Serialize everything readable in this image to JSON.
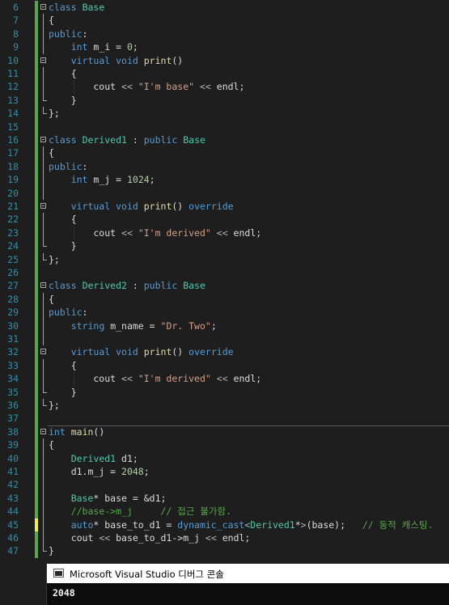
{
  "editor": {
    "lines": [
      {
        "n": "6",
        "fold": "box",
        "chg": "saved",
        "sep": false,
        "guides": [],
        "tokens": [
          [
            "kw",
            "class"
          ],
          [
            "pl",
            " "
          ],
          [
            "ty",
            "Base"
          ]
        ]
      },
      {
        "n": "7",
        "fold": "line",
        "chg": "saved",
        "sep": false,
        "guides": [],
        "tokens": [
          [
            "pl",
            "{"
          ]
        ]
      },
      {
        "n": "8",
        "fold": "line",
        "chg": "saved",
        "sep": false,
        "guides": [],
        "tokens": [
          [
            "kw",
            "public"
          ],
          [
            "pl",
            ":"
          ]
        ]
      },
      {
        "n": "9",
        "fold": "line",
        "chg": "saved",
        "sep": false,
        "guides": [],
        "tokens": [
          [
            "pl",
            "    "
          ],
          [
            "kw",
            "int"
          ],
          [
            "pl",
            " "
          ],
          [
            "mem",
            "m_i"
          ],
          [
            "pl",
            " = "
          ],
          [
            "nm",
            "0"
          ],
          [
            "pl",
            ";"
          ]
        ]
      },
      {
        "n": "10",
        "fold": "box",
        "chg": "saved",
        "sep": false,
        "guides": [],
        "tokens": [
          [
            "pl",
            "    "
          ],
          [
            "kw",
            "virtual"
          ],
          [
            "pl",
            " "
          ],
          [
            "kw",
            "void"
          ],
          [
            "pl",
            " "
          ],
          [
            "fn",
            "print"
          ],
          [
            "pl",
            "()"
          ]
        ]
      },
      {
        "n": "11",
        "fold": "line",
        "chg": "saved",
        "sep": false,
        "guides": [],
        "tokens": [
          [
            "pl",
            "    {"
          ]
        ]
      },
      {
        "n": "12",
        "fold": "line",
        "chg": "saved",
        "sep": false,
        "guides": [
          1
        ],
        "tokens": [
          [
            "pl",
            "        cout "
          ],
          [
            "op",
            "<<"
          ],
          [
            "pl",
            " "
          ],
          [
            "st",
            "\"I'm base\""
          ],
          [
            "pl",
            " "
          ],
          [
            "op",
            "<<"
          ],
          [
            "pl",
            " endl;"
          ]
        ]
      },
      {
        "n": "13",
        "fold": "end",
        "chg": "saved",
        "sep": false,
        "guides": [],
        "tokens": [
          [
            "pl",
            "    }"
          ]
        ]
      },
      {
        "n": "14",
        "fold": "end",
        "chg": "saved",
        "sep": false,
        "guides": [],
        "tokens": [
          [
            "pl",
            "};"
          ]
        ]
      },
      {
        "n": "15",
        "fold": "none",
        "chg": "saved",
        "sep": false,
        "guides": [],
        "tokens": []
      },
      {
        "n": "16",
        "fold": "box",
        "chg": "saved",
        "sep": false,
        "guides": [],
        "tokens": [
          [
            "kw",
            "class"
          ],
          [
            "pl",
            " "
          ],
          [
            "ty",
            "Derived1"
          ],
          [
            "pl",
            " : "
          ],
          [
            "kw",
            "public"
          ],
          [
            "pl",
            " "
          ],
          [
            "ty",
            "Base"
          ]
        ]
      },
      {
        "n": "17",
        "fold": "line",
        "chg": "saved",
        "sep": false,
        "guides": [],
        "tokens": [
          [
            "pl",
            "{"
          ]
        ]
      },
      {
        "n": "18",
        "fold": "line",
        "chg": "saved",
        "sep": false,
        "guides": [],
        "tokens": [
          [
            "kw",
            "public"
          ],
          [
            "pl",
            ":"
          ]
        ]
      },
      {
        "n": "19",
        "fold": "line",
        "chg": "saved",
        "sep": false,
        "guides": [],
        "tokens": [
          [
            "pl",
            "    "
          ],
          [
            "kw",
            "int"
          ],
          [
            "pl",
            " "
          ],
          [
            "mem",
            "m_j"
          ],
          [
            "pl",
            " = "
          ],
          [
            "nm",
            "1024"
          ],
          [
            "pl",
            ";"
          ]
        ]
      },
      {
        "n": "20",
        "fold": "line",
        "chg": "saved",
        "sep": false,
        "guides": [],
        "tokens": []
      },
      {
        "n": "21",
        "fold": "box",
        "chg": "saved",
        "sep": false,
        "guides": [],
        "tokens": [
          [
            "pl",
            "    "
          ],
          [
            "kw",
            "virtual"
          ],
          [
            "pl",
            " "
          ],
          [
            "kw",
            "void"
          ],
          [
            "pl",
            " "
          ],
          [
            "fn",
            "print"
          ],
          [
            "pl",
            "() "
          ],
          [
            "kw",
            "override"
          ]
        ]
      },
      {
        "n": "22",
        "fold": "line",
        "chg": "saved",
        "sep": false,
        "guides": [],
        "tokens": [
          [
            "pl",
            "    {"
          ]
        ]
      },
      {
        "n": "23",
        "fold": "line",
        "chg": "saved",
        "sep": false,
        "guides": [
          1
        ],
        "tokens": [
          [
            "pl",
            "        cout "
          ],
          [
            "op",
            "<<"
          ],
          [
            "pl",
            " "
          ],
          [
            "st",
            "\"I'm derived\""
          ],
          [
            "pl",
            " "
          ],
          [
            "op",
            "<<"
          ],
          [
            "pl",
            " endl;"
          ]
        ]
      },
      {
        "n": "24",
        "fold": "end",
        "chg": "saved",
        "sep": false,
        "guides": [],
        "tokens": [
          [
            "pl",
            "    }"
          ]
        ]
      },
      {
        "n": "25",
        "fold": "end",
        "chg": "saved",
        "sep": false,
        "guides": [],
        "tokens": [
          [
            "pl",
            "};"
          ]
        ]
      },
      {
        "n": "26",
        "fold": "none",
        "chg": "saved",
        "sep": false,
        "guides": [],
        "tokens": []
      },
      {
        "n": "27",
        "fold": "box",
        "chg": "saved",
        "sep": false,
        "guides": [],
        "tokens": [
          [
            "kw",
            "class"
          ],
          [
            "pl",
            " "
          ],
          [
            "ty",
            "Derived2"
          ],
          [
            "pl",
            " : "
          ],
          [
            "kw",
            "public"
          ],
          [
            "pl",
            " "
          ],
          [
            "ty",
            "Base"
          ]
        ]
      },
      {
        "n": "28",
        "fold": "line",
        "chg": "saved",
        "sep": false,
        "guides": [],
        "tokens": [
          [
            "pl",
            "{"
          ]
        ]
      },
      {
        "n": "29",
        "fold": "line",
        "chg": "saved",
        "sep": false,
        "guides": [],
        "tokens": [
          [
            "kw",
            "public"
          ],
          [
            "pl",
            ":"
          ]
        ]
      },
      {
        "n": "30",
        "fold": "line",
        "chg": "saved",
        "sep": false,
        "guides": [],
        "tokens": [
          [
            "pl",
            "    "
          ],
          [
            "kw",
            "string"
          ],
          [
            "pl",
            " "
          ],
          [
            "mem",
            "m_name"
          ],
          [
            "pl",
            " = "
          ],
          [
            "st",
            "\"Dr. Two\""
          ],
          [
            "pl",
            ";"
          ]
        ]
      },
      {
        "n": "31",
        "fold": "line",
        "chg": "saved",
        "sep": false,
        "guides": [],
        "tokens": []
      },
      {
        "n": "32",
        "fold": "box",
        "chg": "saved",
        "sep": false,
        "guides": [],
        "tokens": [
          [
            "pl",
            "    "
          ],
          [
            "kw",
            "virtual"
          ],
          [
            "pl",
            " "
          ],
          [
            "kw",
            "void"
          ],
          [
            "pl",
            " "
          ],
          [
            "fn",
            "print"
          ],
          [
            "pl",
            "() "
          ],
          [
            "kw",
            "override"
          ]
        ]
      },
      {
        "n": "33",
        "fold": "line",
        "chg": "saved",
        "sep": false,
        "guides": [],
        "tokens": [
          [
            "pl",
            "    {"
          ]
        ]
      },
      {
        "n": "34",
        "fold": "line",
        "chg": "saved",
        "sep": false,
        "guides": [
          1
        ],
        "tokens": [
          [
            "pl",
            "        cout "
          ],
          [
            "op",
            "<<"
          ],
          [
            "pl",
            " "
          ],
          [
            "st",
            "\"I'm derived\""
          ],
          [
            "pl",
            " "
          ],
          [
            "op",
            "<<"
          ],
          [
            "pl",
            " endl;"
          ]
        ]
      },
      {
        "n": "35",
        "fold": "end",
        "chg": "saved",
        "sep": false,
        "guides": [],
        "tokens": [
          [
            "pl",
            "    }"
          ]
        ]
      },
      {
        "n": "36",
        "fold": "end",
        "chg": "saved",
        "sep": false,
        "guides": [],
        "tokens": [
          [
            "pl",
            "};"
          ]
        ]
      },
      {
        "n": "37",
        "fold": "none",
        "chg": "saved",
        "sep": false,
        "guides": [],
        "tokens": []
      },
      {
        "n": "38",
        "fold": "box",
        "chg": "saved",
        "sep": true,
        "guides": [],
        "tokens": [
          [
            "kw",
            "int"
          ],
          [
            "pl",
            " "
          ],
          [
            "fn",
            "main"
          ],
          [
            "pl",
            "()"
          ]
        ]
      },
      {
        "n": "39",
        "fold": "line",
        "chg": "saved",
        "sep": false,
        "guides": [],
        "tokens": [
          [
            "pl",
            "{"
          ]
        ]
      },
      {
        "n": "40",
        "fold": "line",
        "chg": "saved",
        "sep": false,
        "guides": [],
        "tokens": [
          [
            "pl",
            "    "
          ],
          [
            "ty",
            "Derived1"
          ],
          [
            "pl",
            " d1;"
          ]
        ]
      },
      {
        "n": "41",
        "fold": "line",
        "chg": "saved",
        "sep": false,
        "guides": [],
        "tokens": [
          [
            "pl",
            "    d1."
          ],
          [
            "mem",
            "m_j"
          ],
          [
            "pl",
            " = "
          ],
          [
            "nm",
            "2048"
          ],
          [
            "pl",
            ";"
          ]
        ]
      },
      {
        "n": "42",
        "fold": "line",
        "chg": "saved",
        "sep": false,
        "guides": [],
        "tokens": []
      },
      {
        "n": "43",
        "fold": "line",
        "chg": "saved",
        "sep": false,
        "guides": [],
        "tokens": [
          [
            "pl",
            "    "
          ],
          [
            "ty",
            "Base"
          ],
          [
            "pl",
            "* base = &d1;"
          ]
        ]
      },
      {
        "n": "44",
        "fold": "line",
        "chg": "saved",
        "sep": false,
        "guides": [],
        "tokens": [
          [
            "pl",
            "    "
          ],
          [
            "cm",
            "//base->m_j     // 접근 불가함."
          ]
        ]
      },
      {
        "n": "45",
        "fold": "line",
        "chg": "unsaved",
        "sep": false,
        "guides": [],
        "tokens": [
          [
            "pl",
            "    "
          ],
          [
            "kw",
            "auto"
          ],
          [
            "pl",
            "* base_to_d1 = "
          ],
          [
            "kw",
            "dynamic_cast"
          ],
          [
            "op",
            "<"
          ],
          [
            "ty",
            "Derived1"
          ],
          [
            "pl",
            "*"
          ],
          [
            "op",
            ">"
          ],
          [
            "pl",
            "(base);   "
          ],
          [
            "cm",
            "// 동적 캐스팅."
          ]
        ]
      },
      {
        "n": "46",
        "fold": "line",
        "chg": "saved",
        "sep": false,
        "guides": [],
        "tokens": [
          [
            "pl",
            "    cout "
          ],
          [
            "op",
            "<<"
          ],
          [
            "pl",
            " base_to_d1->"
          ],
          [
            "mem",
            "m_j"
          ],
          [
            "pl",
            " "
          ],
          [
            "op",
            "<<"
          ],
          [
            "pl",
            " endl;"
          ]
        ]
      },
      {
        "n": "47",
        "fold": "end",
        "chg": "saved",
        "sep": false,
        "guides": [],
        "tokens": [
          [
            "pl",
            "}"
          ]
        ]
      }
    ]
  },
  "console": {
    "title": "Microsoft Visual Studio 디버그 콘솔",
    "output": "2048"
  },
  "colors": {
    "background": "#1e1e1e",
    "line_number": "#2b91af",
    "keyword": "#569cd6",
    "type": "#4ec9b0",
    "function": "#dcdcaa",
    "string": "#d69d85",
    "number": "#b5cea8",
    "comment": "#57a64a",
    "change_saved": "#57a64a",
    "change_unsaved": "#efef53"
  }
}
